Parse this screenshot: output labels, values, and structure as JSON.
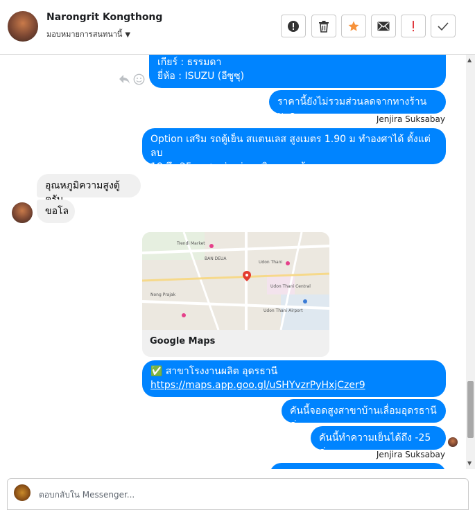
{
  "header": {
    "contact_name": "Narongrit Kongthong",
    "assign_label": "มอบหมายการสนทนานี้"
  },
  "messages": [
    {
      "text_line1": "เกียร์ : ธรรมดา",
      "text_line2": "ยี่ห้อ : ISUZU (อีซูซุ)"
    },
    {
      "text": "ราคานี้ยังไม่รวมส่วนลดจากทางร้านนะคะ"
    },
    {
      "sender": "Jenjira Suksabay"
    },
    {
      "text_line1": "Option เสริม รถตู้เย็น สแตนเลส สูงเมตร 1.90 ม ทำองศาได้ ตั้งแต่ลบ",
      "text_line2": "18 ถึง 25 องศา ช่วงล่างเสริมแหนบล้อ"
    },
    {
      "text": "อุณหภูมิความสูงตู้ครับ"
    },
    {
      "text": "ขอโล"
    },
    {
      "map_caption": "Google Maps"
    },
    {
      "text_line1": "✅ สาขาโรงงานผลิต อุดรธานี",
      "link": "https://maps.app.goo.gl/uSHYvzrPyHxjCzer9"
    },
    {
      "text": "คันนี้จอดสูงสาขาบ้านเลื่อมอุดรธานีค่ะ"
    },
    {
      "text": "คันนี้ทำความเย็นได้ถึง -25 ค่ะ"
    },
    {
      "sender": "Jenjira Suksabay"
    }
  ],
  "map_labels": {
    "l1": "Trendi Market",
    "l2": "Udon Thani",
    "l3": "Nong Prajak",
    "l4": "Udon Thani Central",
    "l5": "Udon Thani Airport",
    "l6": "BAN DEUA"
  },
  "reply": {
    "placeholder": "ตอบกลับใน Messenger..."
  },
  "icons": [
    "alert-icon",
    "trash-icon",
    "star-icon",
    "mail-icon",
    "exclamation-icon",
    "check-icon",
    "reply-icon",
    "emoji-icon",
    "map-pin-icon"
  ],
  "colors": {
    "accent": "#0084ff",
    "incoming": "#f0f0f0",
    "star": "#f7923a"
  }
}
